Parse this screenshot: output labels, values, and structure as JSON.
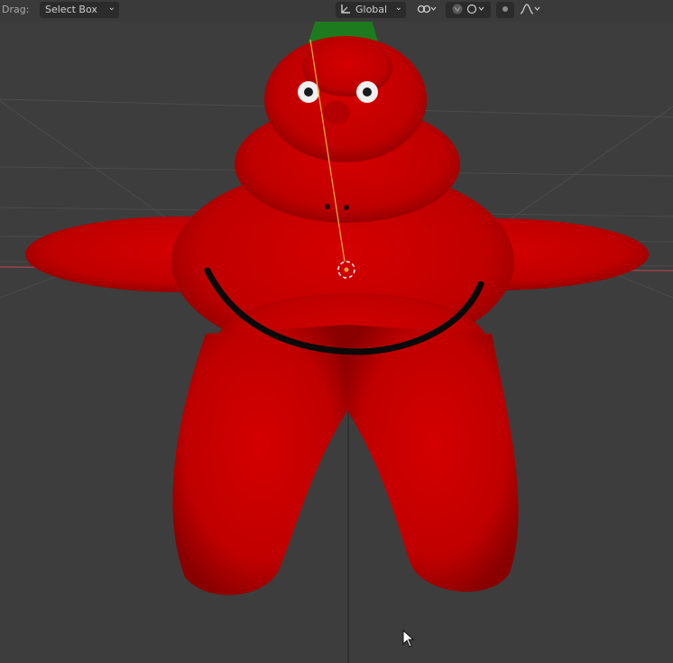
{
  "toolbar": {
    "drag_label": "Drag:",
    "select_mode": {
      "value": "Select Box",
      "icon": "chevron-down-icon"
    },
    "transform_orientation": {
      "value": "Global",
      "icon": "axes-icon"
    },
    "pivot_icon": "link-icon",
    "snap_icon": "magnet-icon",
    "proportional_icon": "proportional-editing-icon",
    "falloff_icon": "falloff-curve-icon"
  },
  "viewport": {
    "background_color": "#3d3d3d",
    "grid_color": "#4a4a4a",
    "x_axis_color": "#a8454a",
    "object_color": "#c00000",
    "hat_color": "#1e7a1e",
    "object_name": ""
  }
}
